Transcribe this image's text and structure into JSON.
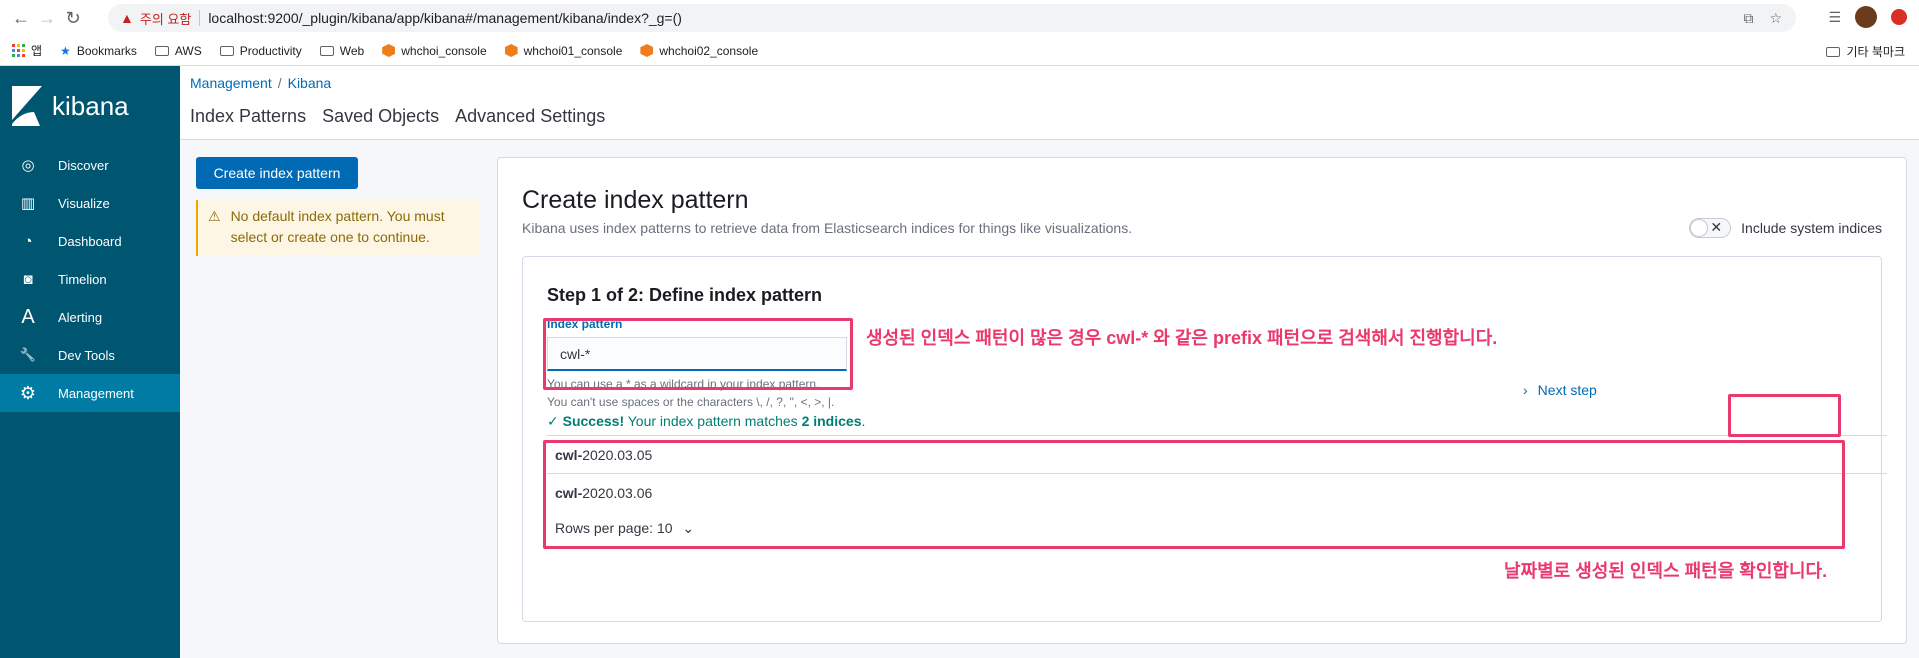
{
  "browser": {
    "warning_label": "주의 요함",
    "url": "localhost:9200/_plugin/kibana/app/kibana#/management/kibana/index?_g=()",
    "bookmarks": [
      {
        "label": "앱",
        "icon": "apps-grid-icon"
      },
      {
        "label": "Bookmarks",
        "icon": "star-icon"
      },
      {
        "label": "AWS",
        "icon": "folder-icon"
      },
      {
        "label": "Productivity",
        "icon": "folder-icon"
      },
      {
        "label": "Web",
        "icon": "folder-icon"
      },
      {
        "label": "whchoi_console",
        "icon": "hexagon-icon"
      },
      {
        "label": "whchoi01_console",
        "icon": "hexagon-icon"
      },
      {
        "label": "whchoi02_console",
        "icon": "hexagon-icon"
      }
    ],
    "other_bookmarks": "기타 북마크"
  },
  "sidebar": {
    "brand": "kibana",
    "items": [
      {
        "label": "Discover",
        "icon": "compass-icon",
        "glyph": "◎"
      },
      {
        "label": "Visualize",
        "icon": "bar-chart-icon",
        "glyph": "▥"
      },
      {
        "label": "Dashboard",
        "icon": "gauge-icon",
        "glyph": "◔"
      },
      {
        "label": "Timelion",
        "icon": "timelion-icon",
        "glyph": "◙"
      },
      {
        "label": "Alerting",
        "icon": "alerting-a-icon",
        "glyph": "A"
      },
      {
        "label": "Dev Tools",
        "icon": "wrench-icon",
        "glyph": "🔧"
      },
      {
        "label": "Management",
        "icon": "gear-icon",
        "glyph": "⚙"
      }
    ]
  },
  "header": {
    "breadcrumbs": [
      "Management",
      "Kibana"
    ],
    "tabs": [
      "Index Patterns",
      "Saved Objects",
      "Advanced Settings"
    ]
  },
  "left": {
    "create_button": "Create index pattern",
    "callout": "No default index pattern. You must select or create one to continue."
  },
  "panel": {
    "title": "Create index pattern",
    "description": "Kibana uses index patterns to retrieve data from Elasticsearch indices for things like visualizations.",
    "system_toggle_label": "Include system indices",
    "system_toggle_on": false,
    "step_title": "Step 1 of 2: Define index pattern",
    "index_label": "Index pattern",
    "index_value": "cwl-*",
    "help_line1": "You can use a * as a wildcard in your index pattern.",
    "help_line2": "You can't use spaces or the characters \\, /, ?, \", <, >, |.",
    "next_label": "Next step",
    "success_bold": "Success!",
    "success_text": " Your index pattern matches ",
    "success_count": "2 indices",
    "success_end": ".",
    "indices": [
      {
        "prefix": "cwl-",
        "rest": "2020.03.05"
      },
      {
        "prefix": "cwl-",
        "rest": "2020.03.06"
      }
    ],
    "rows_per_page": "Rows per page: 10"
  },
  "annotations": {
    "note_pattern": "생성된 인덱스 패턴이 많은 경우 cwl-* 와 같은 prefix 패턴으로 검색해서 진행합니다.",
    "note_dates": "날짜별로 생성된 인덱스 패턴을 확인합니다.",
    "color": "#ea3a6d"
  }
}
